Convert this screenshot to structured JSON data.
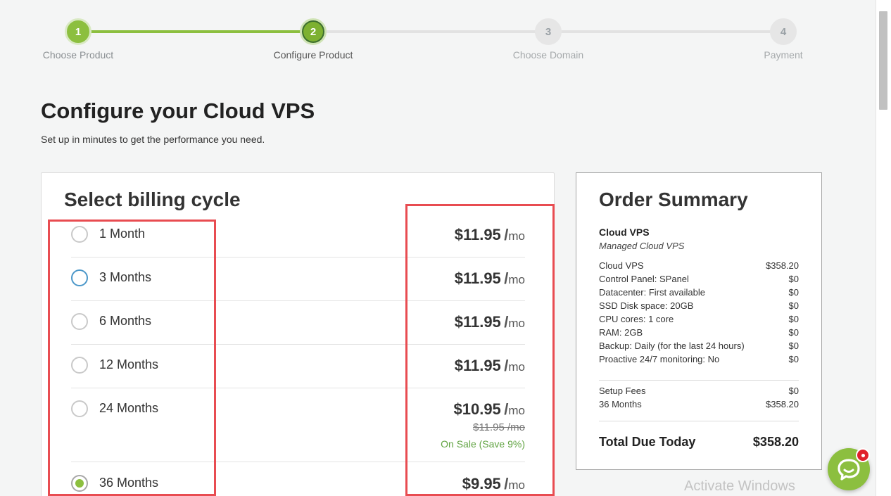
{
  "steps": [
    {
      "num": "1",
      "label": "Choose Product",
      "state": "done"
    },
    {
      "num": "2",
      "label": "Configure Product",
      "state": "current"
    },
    {
      "num": "3",
      "label": "Choose Domain",
      "state": "todo"
    },
    {
      "num": "4",
      "label": "Payment",
      "state": "todo"
    }
  ],
  "page": {
    "title": "Configure your Cloud VPS",
    "subtitle": "Set up in minutes to get the performance you need."
  },
  "billing": {
    "heading": "Select billing cycle",
    "per_slash": "/",
    "per_unit": "mo",
    "options": [
      {
        "label": "1 Month",
        "price": "$11.95",
        "state": "unchecked"
      },
      {
        "label": "3 Months",
        "price": "$11.95",
        "state": "hover"
      },
      {
        "label": "6 Months",
        "price": "$11.95",
        "state": "unchecked"
      },
      {
        "label": "12 Months",
        "price": "$11.95",
        "state": "unchecked"
      },
      {
        "label": "24 Months",
        "price": "$10.95",
        "old_price": "$11.95 /mo",
        "sale": "On Sale (Save 9%)",
        "state": "unchecked"
      },
      {
        "label": "36 Months",
        "price": "$9.95",
        "state": "checked"
      }
    ]
  },
  "summary": {
    "heading": "Order Summary",
    "product": "Cloud VPS",
    "product_sub": "Managed Cloud VPS",
    "lines": [
      {
        "name": "Cloud VPS",
        "value": "$358.20"
      },
      {
        "name": "Control Panel: SPanel",
        "value": "$0"
      },
      {
        "name": "Datacenter: First available",
        "value": "$0"
      },
      {
        "name": "SSD Disk space: 20GB",
        "value": "$0"
      },
      {
        "name": "CPU cores: 1 core",
        "value": "$0"
      },
      {
        "name": "RAM: 2GB",
        "value": "$0"
      },
      {
        "name": "Backup: Daily (for the last 24 hours)",
        "value": "$0"
      },
      {
        "name": "Proactive 24/7 monitoring: No",
        "value": "$0"
      }
    ],
    "fees": [
      {
        "name": "Setup Fees",
        "value": "$0"
      },
      {
        "name": "36 Months",
        "value": "$358.20"
      }
    ],
    "total_label": "Total Due Today",
    "total_value": "$358.20"
  },
  "watermark": "Activate Windows",
  "colors": {
    "accent": "#8cbf3f",
    "annotation": "#e84c51",
    "sale": "#62a443"
  }
}
